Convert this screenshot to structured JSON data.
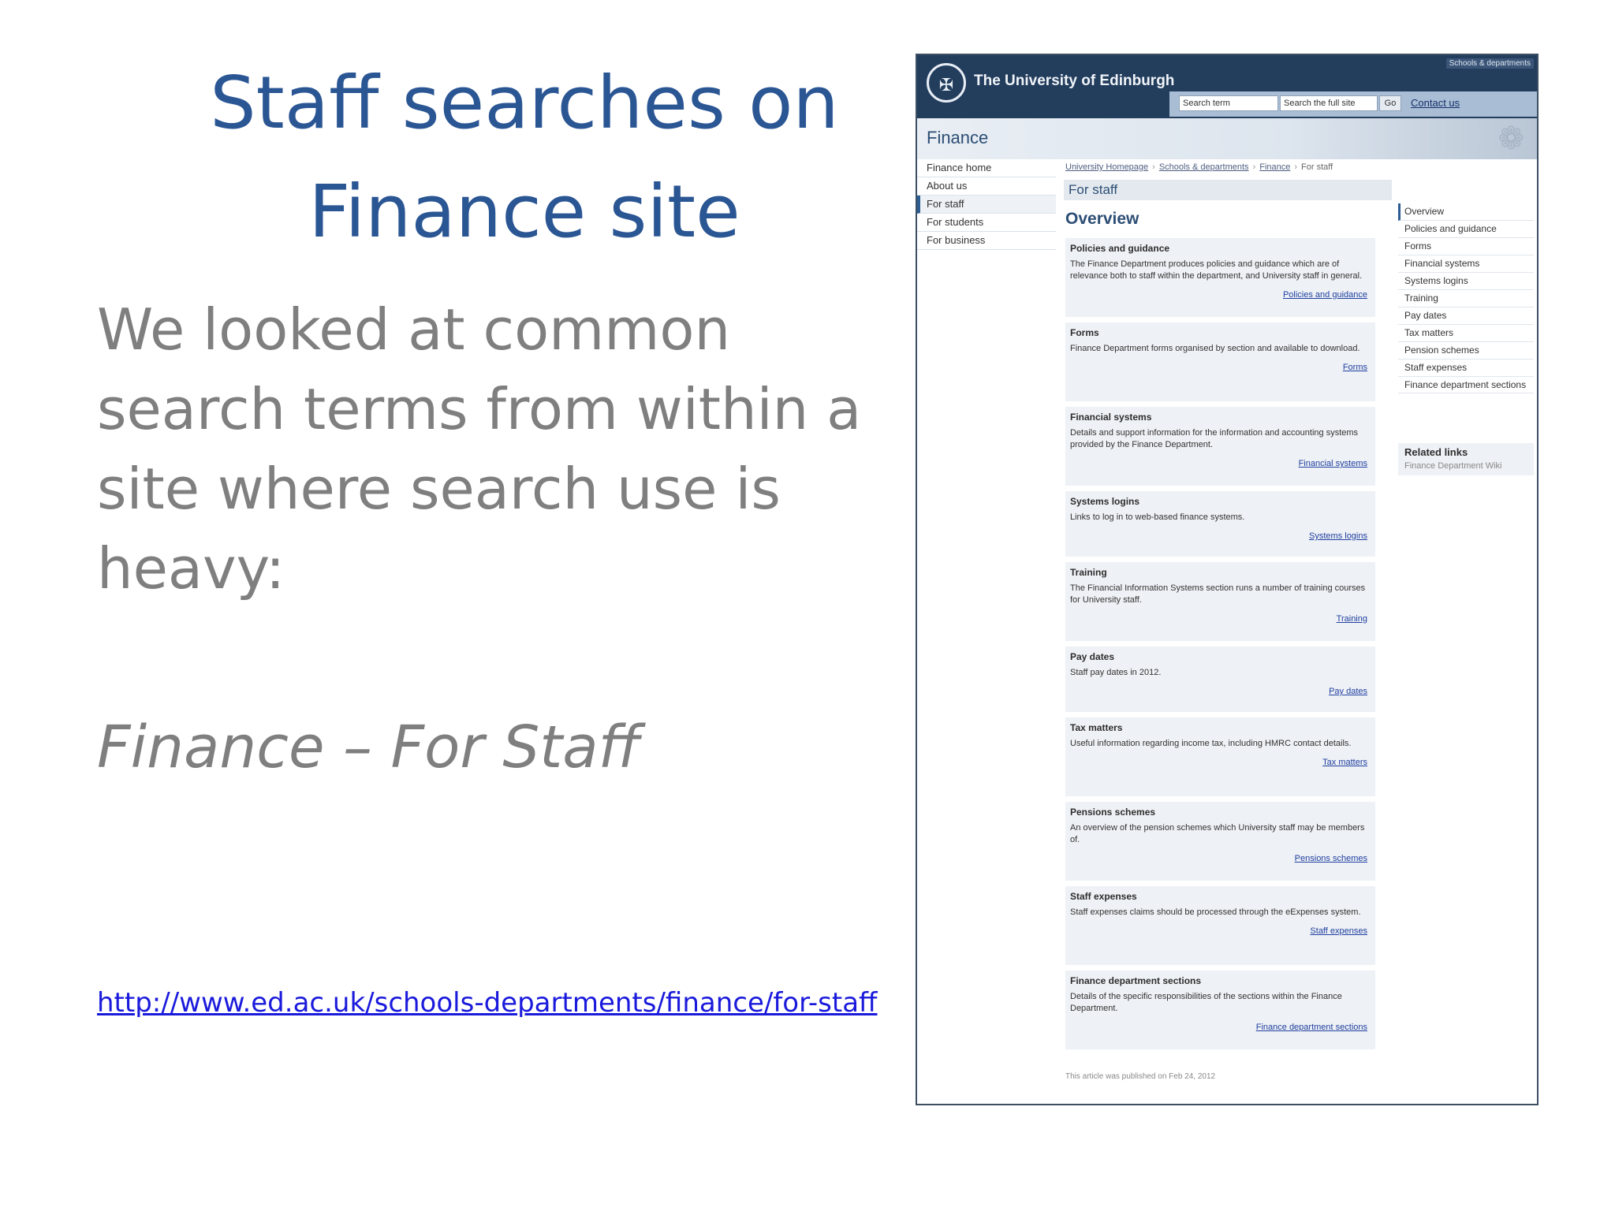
{
  "slide": {
    "title_line1": "Staff searches on",
    "title_line2": "Finance site",
    "body": "We looked at common search terms from within a site where search use is heavy:",
    "subhead": "Finance – For Staff",
    "url": "http://www.ed.ac.uk/schools-departments/finance/for-staff"
  },
  "screenshot": {
    "university": "The University of Edinburgh",
    "schools_link": "Schools & departments",
    "search_placeholder": "Search term",
    "search_scope": "Search the full site",
    "go": "Go",
    "contact": "Contact us",
    "site_name": "Finance",
    "left_nav": [
      "Finance home",
      "About us",
      "For staff",
      "For students",
      "For business"
    ],
    "breadcrumb": [
      "University Homepage",
      "Schools & departments",
      "Finance",
      "For staff"
    ],
    "section_title": "For staff",
    "overview_heading": "Overview",
    "cards": [
      {
        "title": "Policies and guidance",
        "desc": "The Finance Department produces policies and guidance which are of relevance both to staff within the department, and University staff in general.",
        "link": "Policies and guidance"
      },
      {
        "title": "Forms",
        "desc": "Finance Department forms organised by section and available to download.",
        "link": "Forms"
      },
      {
        "title": "Financial systems",
        "desc": "Details and support information for the information and accounting systems provided by the Finance Department.",
        "link": "Financial systems"
      },
      {
        "title": "Systems logins",
        "desc": "Links to log in to web-based finance systems.",
        "link": "Systems logins"
      },
      {
        "title": "Training",
        "desc": "The Financial Information Systems section runs a number of training courses for University staff.",
        "link": "Training"
      },
      {
        "title": "Pay dates",
        "desc": "Staff pay dates in 2012.",
        "link": "Pay dates"
      },
      {
        "title": "Tax matters",
        "desc": "Useful information regarding income tax, including HMRC contact details.",
        "link": "Tax matters"
      },
      {
        "title": "Pensions schemes",
        "desc": "An overview of the pension schemes which University staff may be members of.",
        "link": "Pensions schemes"
      },
      {
        "title": "Staff expenses",
        "desc": "Staff expenses claims should be processed through the eExpenses system.",
        "link": "Staff expenses"
      },
      {
        "title": "Finance department sections",
        "desc": "Details of the specific responsibilities of the sections within the Finance Department.",
        "link": "Finance department sections"
      }
    ],
    "right_nav": [
      "Overview",
      "Policies and guidance",
      "Forms",
      "Financial systems",
      "Systems logins",
      "Training",
      "Pay dates",
      "Tax matters",
      "Pension schemes",
      "Staff expenses",
      "Finance department sections"
    ],
    "related_title": "Related links",
    "related_link": "Finance Department Wiki",
    "published": "This article was published on Feb 24, 2012"
  }
}
